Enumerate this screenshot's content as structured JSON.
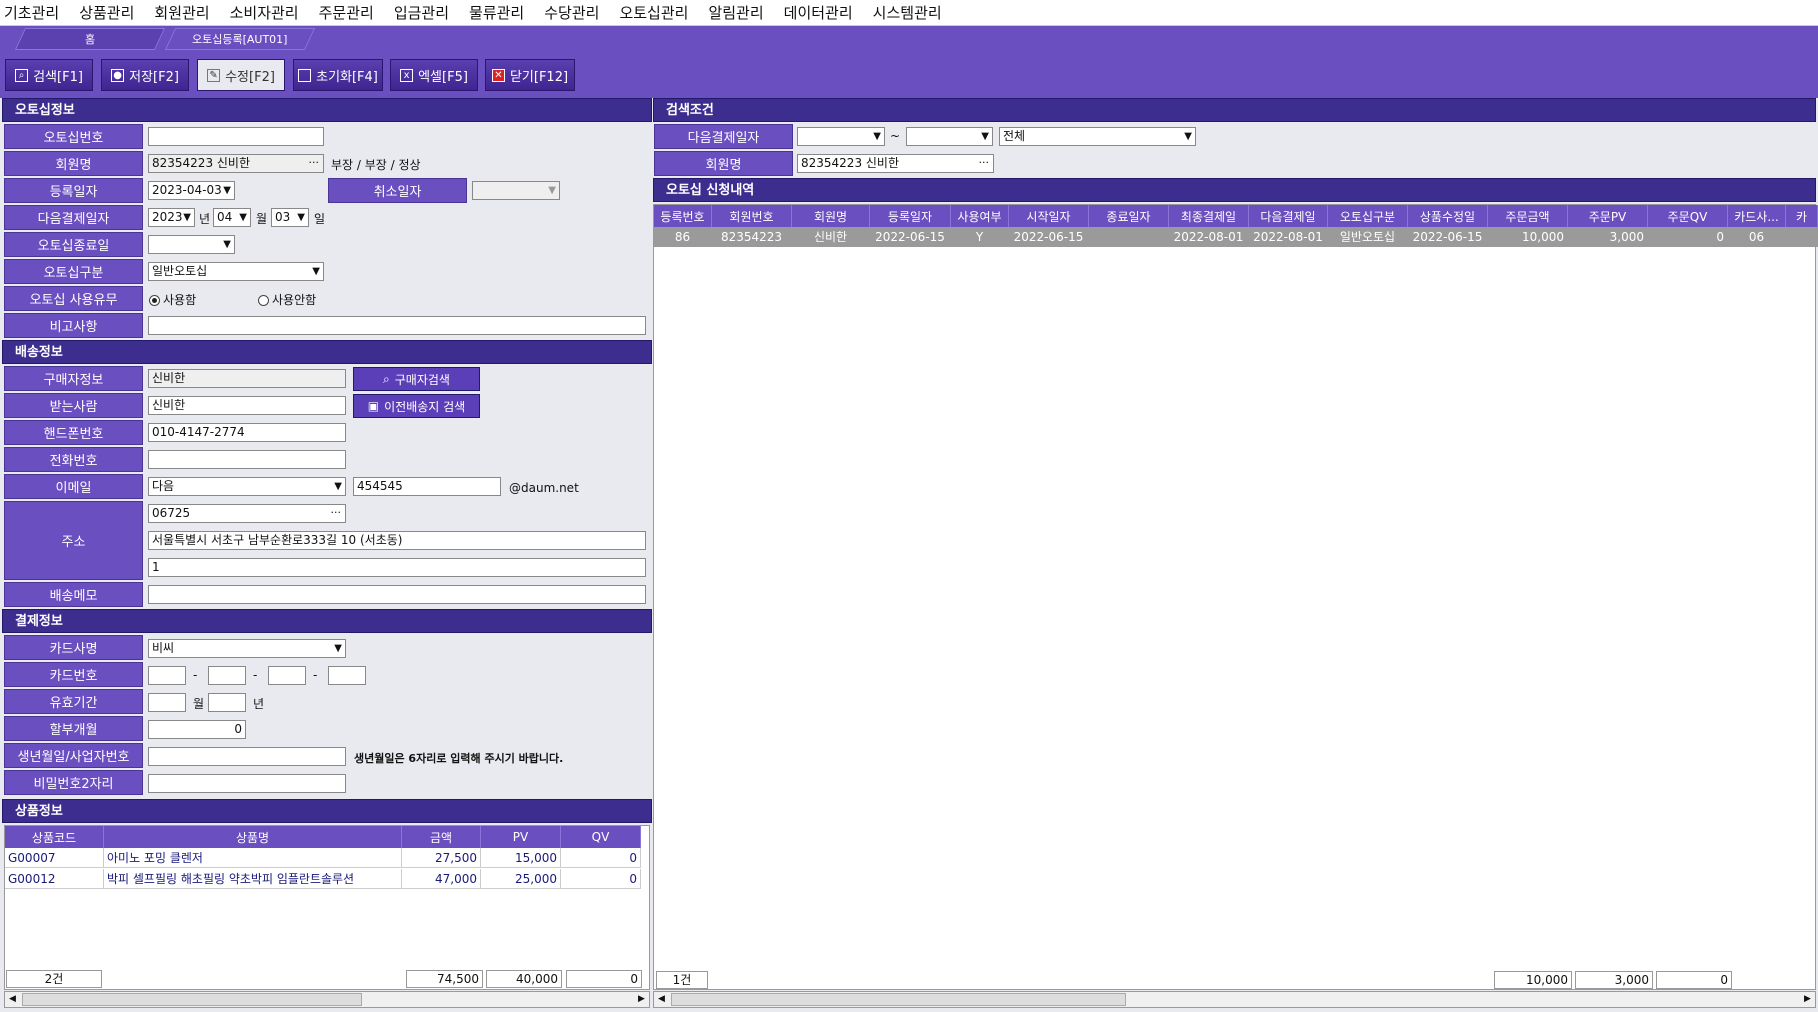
{
  "menu": [
    "기초관리",
    "상품관리",
    "회원관리",
    "소비자관리",
    "주문관리",
    "입금관리",
    "물류관리",
    "수당관리",
    "오토십관리",
    "알림관리",
    "데이터관리",
    "시스템관리"
  ],
  "tabs": {
    "home": "홈",
    "active": "오토십등록[AUT01]"
  },
  "toolbar": {
    "search": "검색[F1]",
    "save": "저장[F2]",
    "edit": "수정[F2]",
    "reset": "초기화[F4]",
    "excel": "엑셀[F5]",
    "close": "닫기[F12]"
  },
  "autoship": {
    "section": "오토십정보",
    "labels": {
      "no": "오토십번호",
      "member": "회원명",
      "reg_date": "등록일자",
      "cancel_date": "취소일자",
      "next_pay": "다음결제일자",
      "end_date": "오토십종료일",
      "type": "오토십구분",
      "use": "오토십 사용유무",
      "memo": "비고사항"
    },
    "member_value": "82354223 신비한",
    "member_rank": "부장 / 부장 / 정상",
    "reg_date": "2023-04-03",
    "next_year": "2023",
    "year_unit": "년",
    "next_month": "04",
    "month_unit": "월",
    "next_day": "03",
    "day_unit": "일",
    "type_value": "일반오토십",
    "use_yes": "사용함",
    "use_no": "사용안함"
  },
  "shipping": {
    "section": "배송정보",
    "labels": {
      "buyer": "구매자정보",
      "receiver": "받는사람",
      "mobile": "핸드폰번호",
      "phone": "전화번호",
      "email": "이메일",
      "address": "주소",
      "memo": "배송메모"
    },
    "buyer": "신비한",
    "buyer_btn": "구매자검색",
    "receiver": "신비한",
    "prev_btn": "이전배송지 검색",
    "mobile": "010-4147-2774",
    "email_domain_select": "다음",
    "email_id": "454545",
    "email_domain": "@daum.net",
    "zip": "06725",
    "addr1": "서울특별시 서초구 남부순환로333길 10 (서초동)",
    "addr2": "1"
  },
  "payment": {
    "section": "결제정보",
    "labels": {
      "card": "카드사명",
      "card_no": "카드번호",
      "expiry": "유효기간",
      "installment": "할부개월",
      "birth": "생년월일/사업자번호",
      "pw": "비밀번호2자리"
    },
    "card": "비씨",
    "dash": "-",
    "month_unit": "월",
    "year_unit": "년",
    "installment": "0",
    "birth_hint": "생년월일은 6자리로 입력해 주시기 바랍니다."
  },
  "products": {
    "section": "상품정보",
    "headers": [
      "상품코드",
      "상품명",
      "금액",
      "PV",
      "QV"
    ],
    "rows": [
      [
        "G00007",
        "아미노 포밍 클렌저",
        "27,500",
        "15,000",
        "0"
      ],
      [
        "G00012",
        "박피 셀프필링 해초필링 약초박피 임플란트솔루션",
        "47,000",
        "25,000",
        "0"
      ]
    ],
    "footer": {
      "count": "2건",
      "amount": "74,500",
      "pv": "40,000",
      "qv": "0"
    }
  },
  "search": {
    "section": "검색조건",
    "labels": {
      "next_pay": "다음결제일자",
      "member": "회원명"
    },
    "tilde": "~",
    "status": "전체",
    "member": "82354223 신비한"
  },
  "list": {
    "section": "오토십 신청내역",
    "headers": [
      "등록번호",
      "회원번호",
      "회원명",
      "등록일자",
      "사용여부",
      "시작일자",
      "종료일자",
      "최종결제일",
      "다음결제일",
      "오토십구분",
      "상품수정일",
      "주문금액",
      "주문PV",
      "주문QV",
      "카드사...",
      "카"
    ],
    "rows": [
      [
        "86",
        "82354223",
        "신비한",
        "2022-06-15",
        "Y",
        "2022-06-15",
        "",
        "2022-08-01",
        "2022-08-01",
        "일반오토십",
        "2022-06-15",
        "10,000",
        "3,000",
        "0",
        "06",
        ""
      ]
    ],
    "footer": {
      "count": "1건",
      "amount": "10,000",
      "pv": "3,000",
      "qv": "0"
    }
  }
}
